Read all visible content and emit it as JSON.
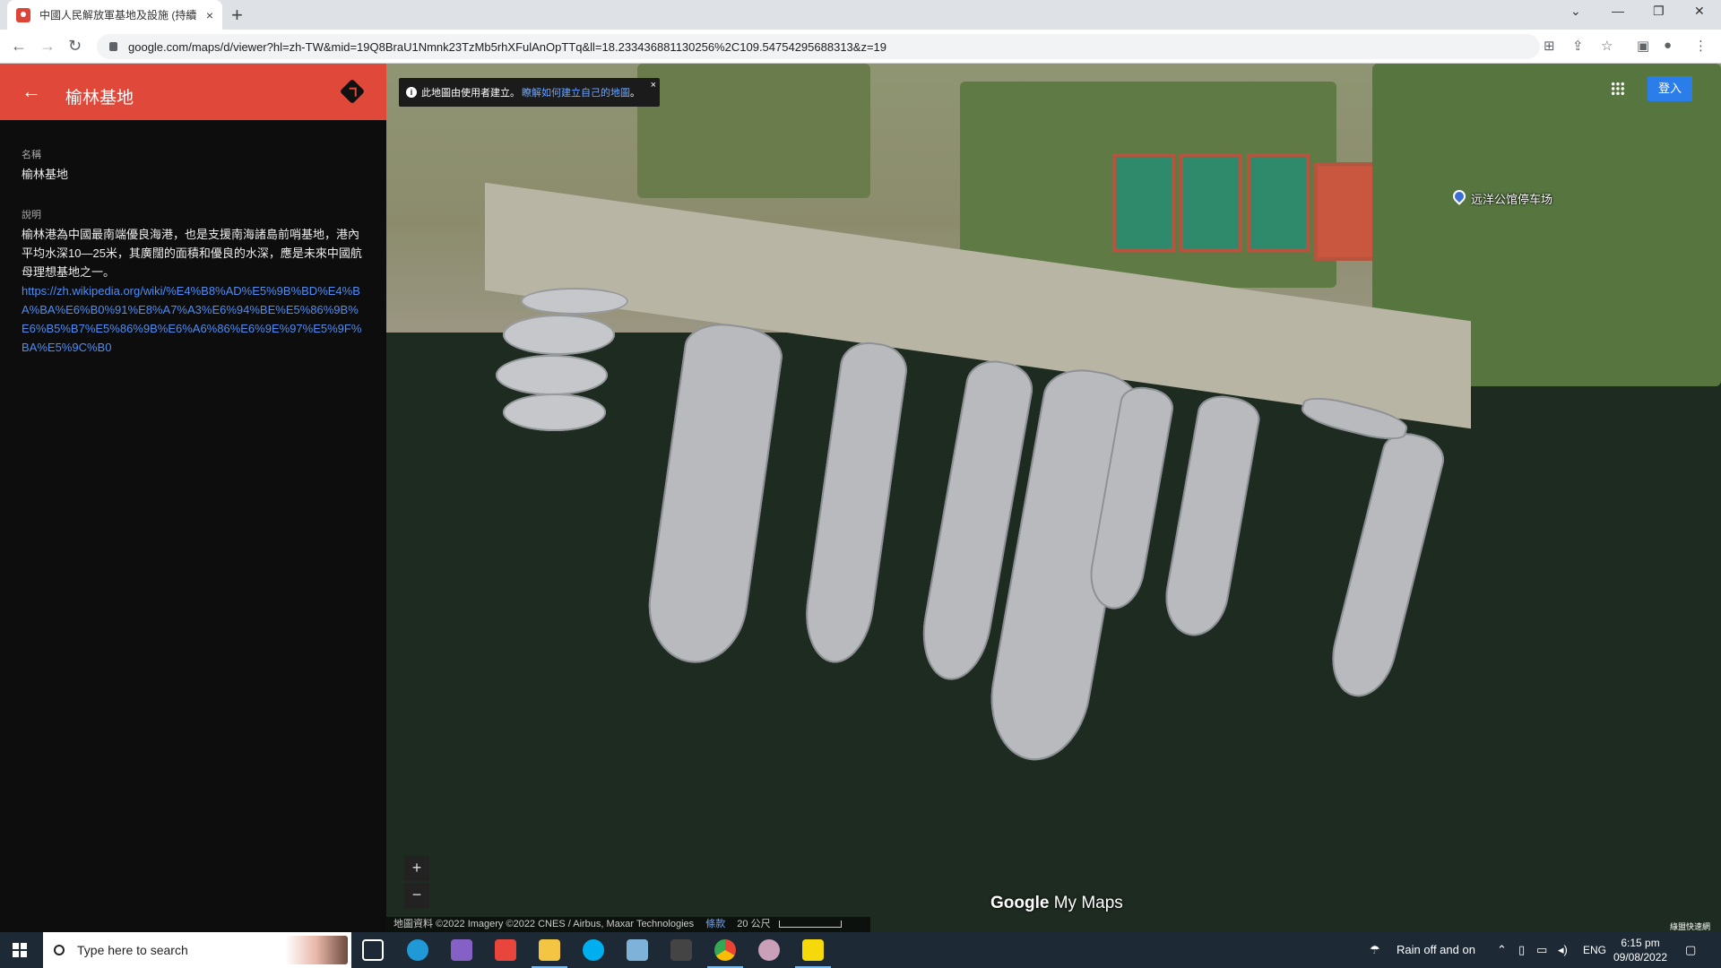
{
  "browser": {
    "tab_title": "中國人民解放軍基地及設施 (持續",
    "tab_close": "×",
    "new_tab": "+",
    "url": "google.com/maps/d/viewer?hl=zh-TW&mid=19Q8BraU1Nmnk23TzMb5rhXFulAnOpTTq&ll=18.233436881130256%2C109.54754295688313&z=19",
    "win_min": "—",
    "win_restore": "❐",
    "win_close": "✕",
    "win_list": "⌄"
  },
  "panel": {
    "title": "榆林基地",
    "name_label": "名稱",
    "name_value": "榆林基地",
    "desc_label": "說明",
    "desc_value": "榆林港為中國最南端優良海港，也是支援南海諸島前哨基地，港內平均水深10—25米，其廣闊的面積和優良的水深，應是未來中國航母理想基地之一。",
    "desc_link": "https://zh.wikipedia.org/wiki/%E4%B8%AD%E5%9B%BD%E4%BA%BA%E6%B0%91%E8%A7%A3%E6%94%BE%E5%86%9B%E6%B5%B7%E5%86%9B%E6%A6%86%E6%9E%97%E5%9F%BA%E5%9C%B0"
  },
  "map": {
    "info_text": "此地圖由使用者建立。",
    "info_link": "瞭解如何建立自己的地圖",
    "info_suffix": "。",
    "info_close": "×",
    "signin": "登入",
    "pin_label": "远洋公馆停车场",
    "zoom_in": "+",
    "zoom_out": "−",
    "brand_google": "Google",
    "brand_mymaps": "My Maps",
    "attribution": "地圖資料 ©2022 Imagery ©2022 CNES / Airbus, Maxar Technologies",
    "terms": "條款",
    "scale": "20 公尺",
    "corner_mark": "綠盟快速網"
  },
  "taskbar": {
    "search_placeholder": "Type here to search",
    "weather": "Rain off and on",
    "lang": "ENG",
    "time": "6:15 pm",
    "date": "09/08/2022"
  }
}
